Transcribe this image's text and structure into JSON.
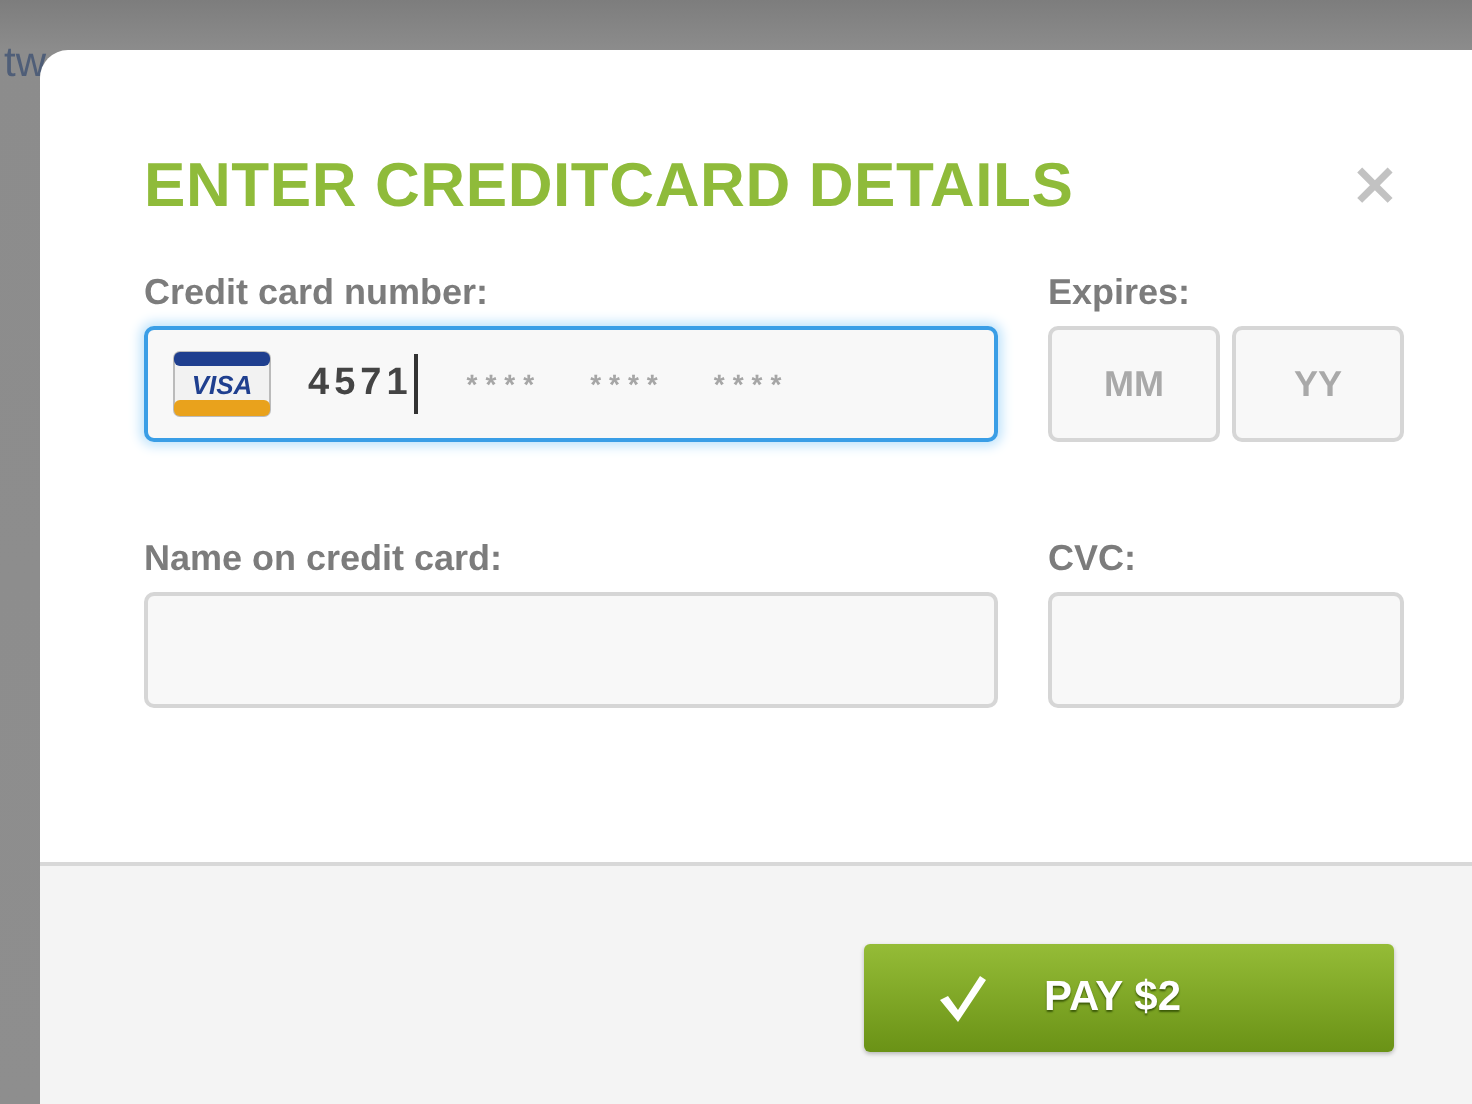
{
  "backdrop": {
    "text": "tw"
  },
  "dialog": {
    "title": "ENTER CREDITCARD DETAILS",
    "close": "×",
    "card_number": {
      "label": "Credit card number:",
      "card_logo": "VISA",
      "value": "4571",
      "focused": true,
      "placeholder_groups": [
        "****",
        "****",
        "****"
      ]
    },
    "expires": {
      "label": "Expires:",
      "fields": [
        {
          "placeholder": "MM"
        },
        {
          "placeholder": "YY"
        }
      ]
    },
    "name": {
      "label": "Name on credit card:"
    },
    "cvc": {
      "label": "CVC:"
    },
    "pay_button": {
      "label": "PAY $2"
    }
  }
}
